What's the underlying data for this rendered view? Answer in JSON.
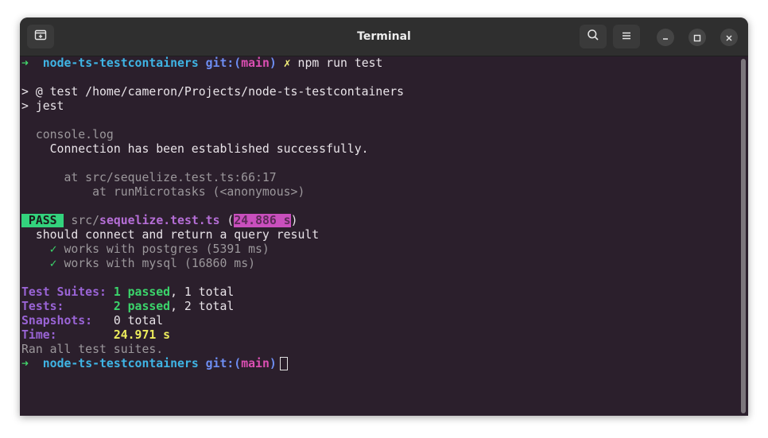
{
  "window": {
    "title": "Terminal"
  },
  "icons": {
    "new_tab": "new-tab-icon",
    "search": "search-icon",
    "menu": "hamburger-menu-icon",
    "minimize": "minimize-icon",
    "maximize": "maximize-icon",
    "close": "close-icon"
  },
  "colors": {
    "background": "#2b1f2c",
    "prompt_arrow": "#42d36a",
    "directory": "#3fb4e4",
    "branch": "#dc4fb3",
    "pass": "#33d37d",
    "summary_label": "#9a64d6",
    "time_value": "#ecec5c"
  },
  "prompt": {
    "arrow": "➜",
    "directory": "node-ts-testcontainers",
    "git_prefix": "git:(",
    "branch": "main",
    "git_suffix": ")",
    "dirty_mark": "✗",
    "command": "npm run test"
  },
  "npm": {
    "line1": "> @ test /home/cameron/Projects/node-ts-testcontainers",
    "line2": "> jest"
  },
  "console": {
    "header": "console.log",
    "message": "Connection has been established successfully.",
    "at1": "at src/sequelize.test.ts:66:17",
    "at2": "at runMicrotasks (<anonymous>)"
  },
  "result": {
    "badge": "PASS",
    "dir": "src/",
    "file": "sequelize.test.ts",
    "open": "(",
    "duration": "24.886 s",
    "close": ")",
    "describe": "should connect and return a query result",
    "tests": [
      {
        "check": "✓",
        "name": "works with postgres (5391 ms)"
      },
      {
        "check": "✓",
        "name": "works with mysql (16860 ms)"
      }
    ]
  },
  "summary": {
    "suites_label": "Test Suites:",
    "suites_passed": "1 passed",
    "suites_total": ", 1 total",
    "tests_label": "Tests:",
    "tests_passed": "2 passed",
    "tests_total": ", 2 total",
    "snapshots_label": "Snapshots:",
    "snapshots_value": "0 total",
    "time_label": "Time:",
    "time_value": "24.971 s",
    "ran_all": "Ran all test suites."
  }
}
